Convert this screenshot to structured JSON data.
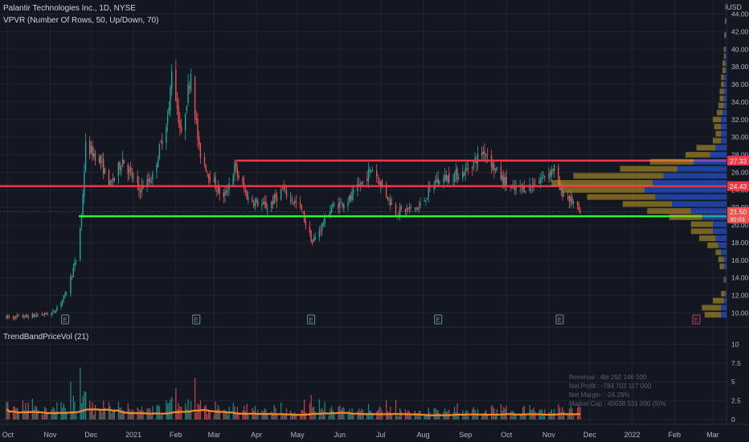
{
  "header": {
    "symbol_line": "Palantir Technologies Inc., 1D, NYSE",
    "indicator_line": "VPVR (Number Of Rows, 50, Up/Down, 70)",
    "volume_indicator": "TrendBandPriceVol (21)",
    "currency": "USD"
  },
  "fundamentals": [
    "Revenue : 4bt 292 146 000",
    "Net Profit : -784 702 117 000",
    "Net Margin : -24.29%",
    "Market Cap : 40638 531 000 (9)%"
  ],
  "earnings_marker": "E",
  "colors": {
    "background": "#131722",
    "grid": "#1f2430",
    "up": "#26a69a",
    "down": "#ef5350",
    "resistance": "#f23645",
    "support": "#1dff2f",
    "trendband": "#f68b2a",
    "vp_up": "#2962ff",
    "vp_down": "#c9a227",
    "earnings": "#6f8f8a",
    "earnings_future": "#d03c6a"
  },
  "chart_data": {
    "type": "candlestick",
    "x_ticks": [
      "Oct",
      "Nov",
      "Dec",
      "2021",
      "Feb",
      "Mar",
      "Apr",
      "May",
      "Jun",
      "Jul",
      "Aug",
      "Sep",
      "Oct",
      "Nov",
      "Dec",
      "2022",
      "Feb",
      "Mar"
    ],
    "y_ticks": [
      "10.00",
      "12.00",
      "14.00",
      "16.00",
      "18.00",
      "20.00",
      "22.00",
      "24.00",
      "26.00",
      "28.00",
      "30.00",
      "32.00",
      "34.00",
      "36.00",
      "38.00",
      "40.00",
      "42.00",
      "44.00"
    ],
    "y_range": [
      8.4,
      45.6
    ],
    "volume_ticks": [
      "0",
      "2.5",
      "5",
      "7.5",
      "10"
    ],
    "volume_range": [
      0,
      11
    ],
    "price_anchors": [
      [
        "2020-09-30",
        9.5
      ],
      [
        "2020-10-15",
        9.6
      ],
      [
        "2020-11-03",
        10.0
      ],
      [
        "2020-11-12",
        12.0
      ],
      [
        "2020-11-20",
        16.0
      ],
      [
        "2020-11-24",
        21.0
      ],
      [
        "2020-11-27",
        29.0
      ],
      [
        "2020-12-07",
        27.5
      ],
      [
        "2020-12-15",
        24.5
      ],
      [
        "2020-12-24",
        27.5
      ],
      [
        "2021-01-05",
        24.0
      ],
      [
        "2021-01-15",
        25.5
      ],
      [
        "2021-01-27",
        33.0
      ],
      [
        "2021-01-29",
        38.0
      ],
      [
        "2021-02-05",
        30.0
      ],
      [
        "2021-02-12",
        37.5
      ],
      [
        "2021-02-18",
        28.5
      ],
      [
        "2021-02-26",
        25.5
      ],
      [
        "2021-03-08",
        23.0
      ],
      [
        "2021-03-16",
        26.5
      ],
      [
        "2021-03-26",
        23.0
      ],
      [
        "2021-04-09",
        22.0
      ],
      [
        "2021-04-20",
        24.0
      ],
      [
        "2021-05-03",
        22.0
      ],
      [
        "2021-05-12",
        18.0
      ],
      [
        "2021-05-26",
        22.0
      ],
      [
        "2021-06-09",
        23.0
      ],
      [
        "2021-06-25",
        26.5
      ],
      [
        "2021-07-12",
        21.5
      ],
      [
        "2021-07-29",
        22.0
      ],
      [
        "2021-08-10",
        25.0
      ],
      [
        "2021-08-31",
        26.0
      ],
      [
        "2021-09-15",
        28.5
      ],
      [
        "2021-09-24",
        26.0
      ],
      [
        "2021-10-05",
        24.0
      ],
      [
        "2021-10-20",
        24.5
      ],
      [
        "2021-11-05",
        26.5
      ],
      [
        "2021-11-09",
        24.0
      ],
      [
        "2021-11-19",
        22.5
      ],
      [
        "2021-11-24",
        21.4
      ]
    ],
    "earnings_dates": [
      "2020-11-12",
      "2021-02-16",
      "2021-05-11",
      "2021-08-12",
      "2021-11-09",
      "2022-02-17"
    ],
    "lines": [
      {
        "name": "resistance-high",
        "price": 27.33,
        "from": "2021-03-17",
        "label": "27.33"
      },
      {
        "name": "resistance-mid",
        "price": 24.43,
        "from": "2020-09-30",
        "label": "24.43"
      },
      {
        "name": "support",
        "price": 21.0,
        "from": "2020-11-22",
        "label": "21.00"
      }
    ],
    "last_price": "21.50",
    "countdown": "30:03",
    "volume_profile": [
      {
        "price": 9.8,
        "up": 0.2,
        "down": 0.6
      },
      {
        "price": 10.6,
        "up": 0.2,
        "down": 0.7
      },
      {
        "price": 11.4,
        "up": 0.1,
        "down": 0.4
      },
      {
        "price": 12.2,
        "up": 0.05,
        "down": 0.15
      },
      {
        "price": 13.8,
        "up": 0.05,
        "down": 0.05
      },
      {
        "price": 15.3,
        "up": 0.1,
        "down": 0.15
      },
      {
        "price": 16.1,
        "up": 0.1,
        "down": 0.2
      },
      {
        "price": 16.9,
        "up": 0.2,
        "down": 0.2
      },
      {
        "price": 17.7,
        "up": 0.3,
        "down": 0.4
      },
      {
        "price": 18.5,
        "up": 0.4,
        "down": 0.6
      },
      {
        "price": 19.3,
        "up": 0.5,
        "down": 0.8
      },
      {
        "price": 20.1,
        "up": 0.5,
        "down": 0.8
      },
      {
        "price": 20.9,
        "up": 0.9,
        "down": 1.2
      },
      {
        "price": 21.6,
        "up": 1.3,
        "down": 1.6
      },
      {
        "price": 22.4,
        "up": 2.0,
        "down": 1.8
      },
      {
        "price": 23.2,
        "up": 2.6,
        "down": 2.5
      },
      {
        "price": 24.0,
        "up": 3.0,
        "down": 3.0
      },
      {
        "price": 24.8,
        "up": 2.7,
        "down": 3.7
      },
      {
        "price": 25.6,
        "up": 2.3,
        "down": 3.3
      },
      {
        "price": 26.4,
        "up": 1.8,
        "down": 2.1
      },
      {
        "price": 27.2,
        "up": 1.2,
        "down": 1.6
      },
      {
        "price": 28.0,
        "up": 0.6,
        "down": 0.9
      },
      {
        "price": 28.8,
        "up": 0.4,
        "down": 0.7
      },
      {
        "price": 29.6,
        "up": 0.2,
        "down": 0.3
      },
      {
        "price": 30.4,
        "up": 0.2,
        "down": 0.2
      },
      {
        "price": 31.2,
        "up": 0.2,
        "down": 0.25
      },
      {
        "price": 32.0,
        "up": 0.2,
        "down": 0.3
      },
      {
        "price": 32.8,
        "up": 0.15,
        "down": 0.2
      },
      {
        "price": 33.6,
        "up": 0.1,
        "down": 0.2
      },
      {
        "price": 34.4,
        "up": 0.1,
        "down": 0.15
      },
      {
        "price": 35.2,
        "up": 0.1,
        "down": 0.15
      },
      {
        "price": 36.0,
        "up": 0.1,
        "down": 0.1
      },
      {
        "price": 36.8,
        "up": 0.1,
        "down": 0.1
      },
      {
        "price": 37.6,
        "up": 0.05,
        "down": 0.1
      },
      {
        "price": 38.4,
        "up": 0.05,
        "down": 0.1
      },
      {
        "price": 39.2,
        "up": 0.05,
        "down": 0.05
      },
      {
        "price": 40.0,
        "up": 0.05,
        "down": 0.05
      },
      {
        "price": 41.6,
        "up": 0.03,
        "down": 0.05
      },
      {
        "price": 43.2,
        "up": 0.02,
        "down": 0.04
      },
      {
        "price": 44.8,
        "up": 0.02,
        "down": 0.03
      }
    ],
    "grid": true,
    "legend": "top-left"
  }
}
